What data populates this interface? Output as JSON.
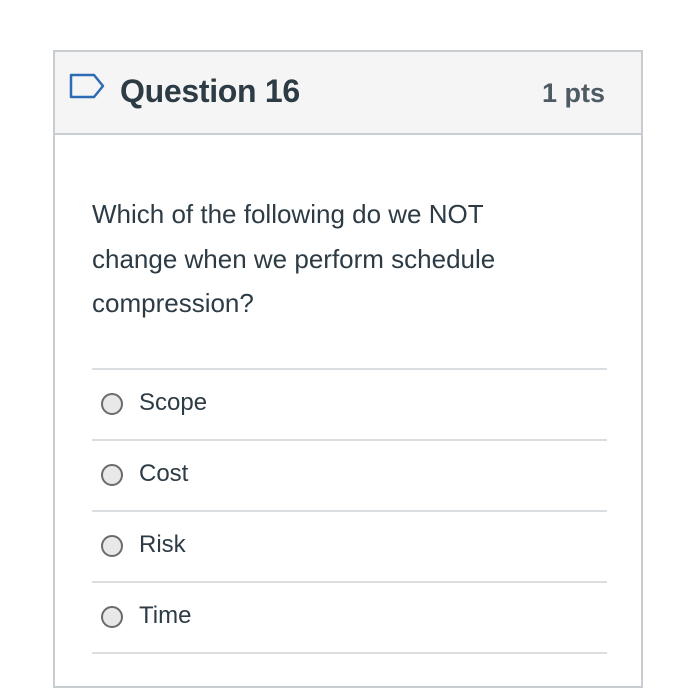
{
  "question": {
    "title": "Question 16",
    "points": "1 pts",
    "text": "Which of the following do we NOT change when we perform schedule compression?",
    "flag_icon": "flag-icon"
  },
  "answers": [
    {
      "label": "Scope",
      "selected": false
    },
    {
      "label": "Cost",
      "selected": false
    },
    {
      "label": "Risk",
      "selected": false
    },
    {
      "label": "Time",
      "selected": false
    }
  ],
  "colors": {
    "header_background": "#f5f5f5",
    "border": "#c7cdd1",
    "text": "#2d3b45",
    "flag": "#2d6bb5"
  }
}
